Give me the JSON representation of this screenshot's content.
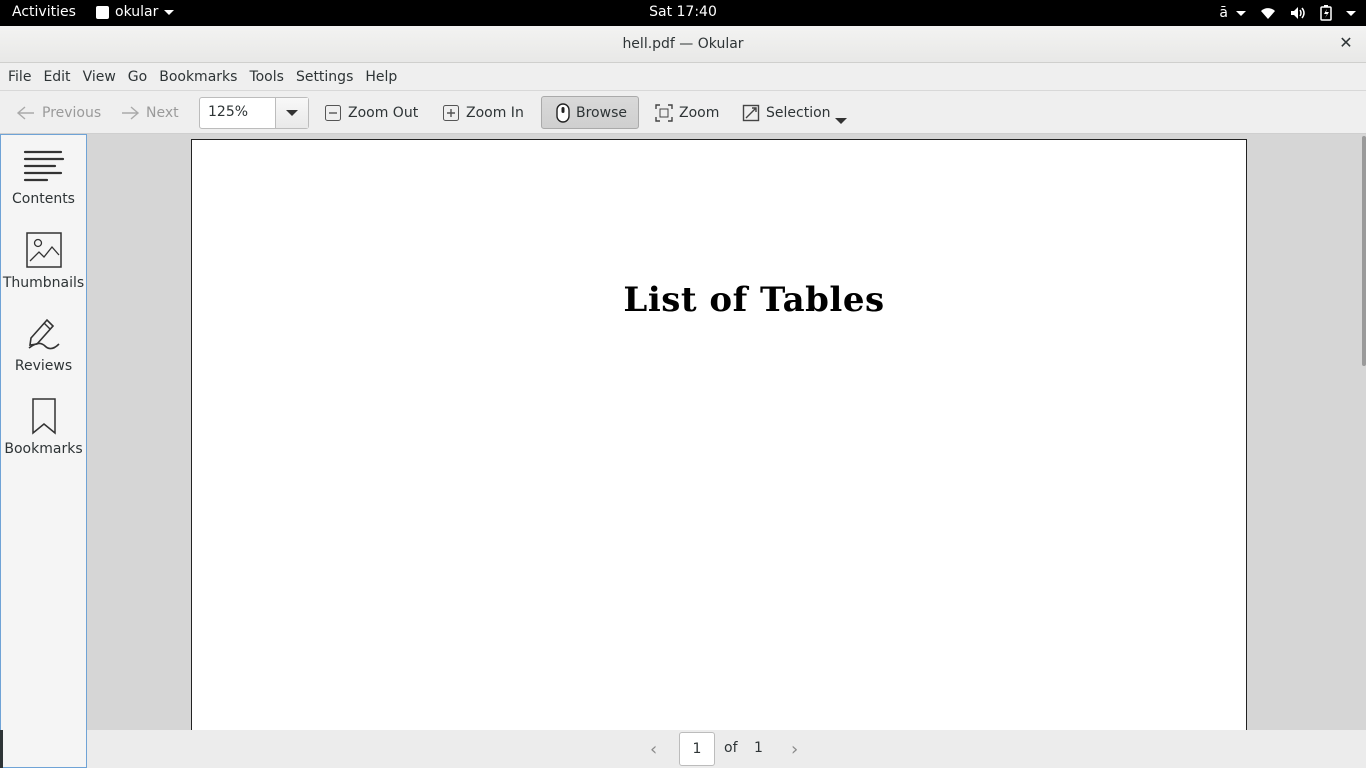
{
  "topbar": {
    "activities": "Activities",
    "app_name": "okular",
    "clock": "Sat 17:40",
    "input_indicator": "ā"
  },
  "window": {
    "title": "hell.pdf — Okular",
    "close": "✕"
  },
  "menu": {
    "items": [
      "File",
      "Edit",
      "View",
      "Go",
      "Bookmarks",
      "Tools",
      "Settings",
      "Help"
    ]
  },
  "toolbar": {
    "previous": "Previous",
    "next": "Next",
    "zoom_value": "125%",
    "zoom_out": "Zoom Out",
    "zoom_in": "Zoom In",
    "browse": "Browse",
    "zoom_tool": "Zoom",
    "selection": "Selection"
  },
  "sidebar": {
    "items": [
      {
        "label": "Contents",
        "icon": "contents-icon"
      },
      {
        "label": "Thumbnails",
        "icon": "thumbnails-icon"
      },
      {
        "label": "Reviews",
        "icon": "reviews-icon"
      },
      {
        "label": "Bookmarks",
        "icon": "bookmark-icon"
      }
    ]
  },
  "document": {
    "heading": "List of Tables"
  },
  "pagebar": {
    "current_page": "1",
    "of": "of",
    "total_pages": "1"
  }
}
